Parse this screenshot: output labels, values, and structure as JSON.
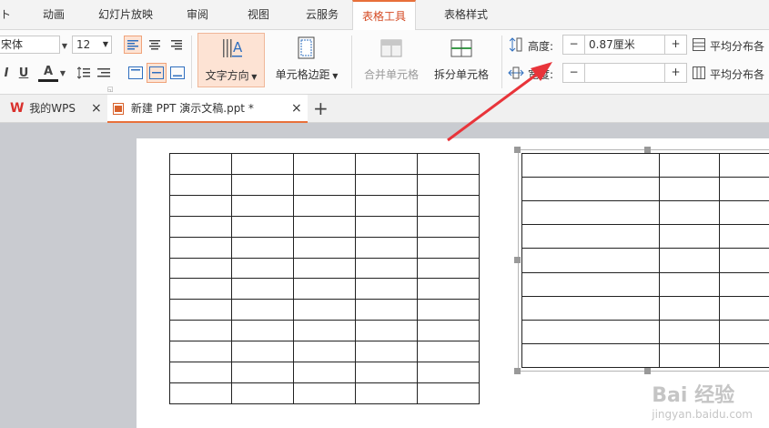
{
  "menu": {
    "tabs": [
      {
        "label": "动画"
      },
      {
        "label": "幻灯片放映"
      },
      {
        "label": "审阅"
      },
      {
        "label": "视图"
      },
      {
        "label": "云服务"
      },
      {
        "label": "表格工具"
      },
      {
        "label": "表格样式"
      }
    ]
  },
  "ribbon": {
    "font_name": "宋体",
    "font_size": "12",
    "text_direction_label": "文字方向",
    "cell_margin_label": "单元格边距",
    "merge_cells_label": "合并单元格",
    "split_cells_label": "拆分单元格",
    "height_label": "高度:",
    "height_value": "0.87厘米",
    "width_label": "宽度:",
    "width_value": "",
    "distribute_rows_label": "平均分布各",
    "distribute_cols_label": "平均分布各",
    "minus": "−",
    "plus": "+"
  },
  "doc_tabs": [
    {
      "label": "我的WPS",
      "close": "×"
    },
    {
      "label": "新建 PPT 演示文稿.ppt *",
      "close": "×"
    }
  ],
  "new_tab_symbol": "+",
  "colors": {
    "accent": "#e8703a",
    "active_tab_text": "#d44a23",
    "arrow": "#e8343a",
    "wps_logo": "#d9302c"
  },
  "tables": {
    "left": {
      "rows": 12,
      "cols": 5
    },
    "right": {
      "rows": 9,
      "cols": 3
    }
  },
  "watermark": {
    "brand": "Bai 经验",
    "url": "jingyan.baidu.com"
  }
}
